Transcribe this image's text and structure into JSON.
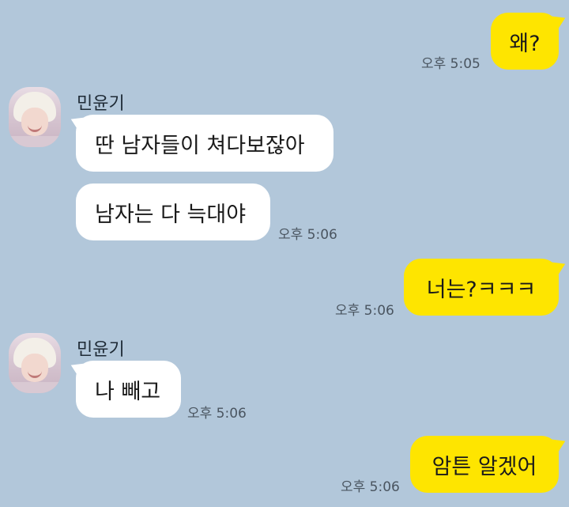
{
  "chat": {
    "messages": [
      {
        "text": "왜?",
        "time": "오후 5:05"
      },
      {
        "sender": "민윤기",
        "text": "딴 남자들이 쳐다보잖아"
      },
      {
        "text": "남자는 다 늑대야",
        "time": "오후 5:06"
      },
      {
        "text": "너는?ㅋㅋㅋ",
        "time": "오후 5:06"
      },
      {
        "sender": "민윤기",
        "text": "나 빼고",
        "time": "오후 5:06"
      },
      {
        "text": "암튼 알겠어",
        "time": "오후 5:06"
      }
    ]
  },
  "colors": {
    "background": "#b2c7da",
    "my_bubble": "#fee500",
    "their_bubble": "#ffffff"
  }
}
